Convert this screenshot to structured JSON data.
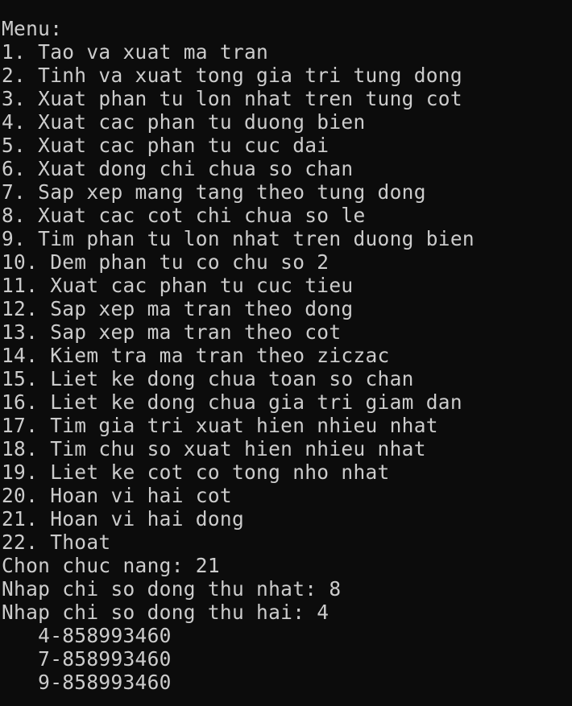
{
  "terminal": {
    "menu_header": "Menu:",
    "menu_items": [
      "1. Tao va xuat ma tran",
      "2. Tinh va xuat tong gia tri tung dong",
      "3. Xuat phan tu lon nhat tren tung cot",
      "4. Xuat cac phan tu duong bien",
      "5. Xuat cac phan tu cuc dai",
      "6. Xuat dong chi chua so chan",
      "7. Sap xep mang tang theo tung dong",
      "8. Xuat cac cot chi chua so le",
      "9. Tim phan tu lon nhat tren duong bien",
      "10. Dem phan tu co chu so 2",
      "11. Xuat cac phan tu cuc tieu",
      "12. Sap xep ma tran theo dong",
      "13. Sap xep ma tran theo cot",
      "14. Kiem tra ma tran theo ziczac",
      "15. Liet ke dong chua toan so chan",
      "16. Liet ke dong chua gia tri giam dan",
      "17. Tim gia tri xuat hien nhieu nhat",
      "18. Tim chu so xuat hien nhieu nhat",
      "19. Liet ke cot co tong nho nhat",
      "20. Hoan vi hai cot",
      "21. Hoan vi hai dong",
      "22. Thoat"
    ],
    "prompt_choice": "Chon chuc nang: 21",
    "prompt_row1": "Nhap chi so dong thu nhat: 8",
    "prompt_row2": "Nhap chi so dong thu hai: 4",
    "output_lines": [
      "   4-858993460",
      "   7-858993460",
      "   9-858993460"
    ]
  }
}
